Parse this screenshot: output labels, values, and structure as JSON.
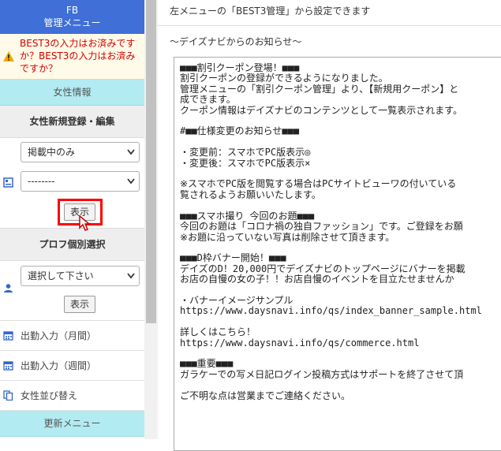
{
  "sidebar": {
    "title_line1": "FB",
    "title_line2": "管理メニュー",
    "warning_text": "BEST3の入力はお済みですか？BEST3の入力はお済みですか？",
    "section_women": "女性情報",
    "section_new_edit": "女性新規登録・編集",
    "select_status": "掲載中のみ",
    "select_second": "--------",
    "show_button": "表示",
    "section_profile": "プロフ個別選択",
    "select_profile": "選択して下さい",
    "show_button_2": "表示",
    "menu_items": [
      {
        "label": "出勤入力（月間）",
        "icon": "calendar-icon"
      },
      {
        "label": "出勤入力（週間）",
        "icon": "calendar-icon"
      },
      {
        "label": "女性並び替え",
        "icon": "copy-icon"
      }
    ],
    "section_update": "更新メニュー"
  },
  "main": {
    "intro": "左メニューの「BEST3管理」から設定できます",
    "news_heading": "〜デイズナビからのお知らせ〜",
    "news_body": "■■■割引クーポン登場！■■■\n割引クーポンの登録ができるようになりました。\n管理メニューの「割引クーポン管理」より、【新規用クーポン】と\n成できます。\nクーポン情報はデイズナビのコンテンツとして一覧表示されます。\n\n#■■仕様変更のお知らせ■■■\n\n・変更前：スマホでPC版表示◎\n・変更後：スマホでPC版表示×\n\n※スマホでPC版を閲覧する場合はPCサイトビューワの付いている\n覧されるようお願いいたします。\n\n■■■スマホ撮り 今回のお題■■■\n今回のお題は「コロナ禍の独自ファッション」です。ご登録をお願\n※お題に沿っていない写真は削除させて頂きます。\n\n■■■D枠バナー開始！■■■\nデイズのD！20,000円でデイズナビのトップページにバナーを掲載\nお店の自慢の女の子！！お店自慢のイベントを目立たせませんか\n\n・バナーイメージサンプル\nhttps://www.daysnavi.info/qs/index_banner_sample.html\n\n詳しくはこちら！\nhttps://www.daysnavi.info/qs/commerce.html\n\n■■■重要■■■\nガラケーでの写メ日記ログイン投稿方式はサポートを終了させて頂\n\nご不明な点は営業までご連絡ください。"
  },
  "colors": {
    "header_blue": "#3f6fd7",
    "section_cyan": "#b2ebf2",
    "warning_red": "#d40000",
    "highlight_red": "#ff0000",
    "icon_blue": "#3366cc"
  }
}
